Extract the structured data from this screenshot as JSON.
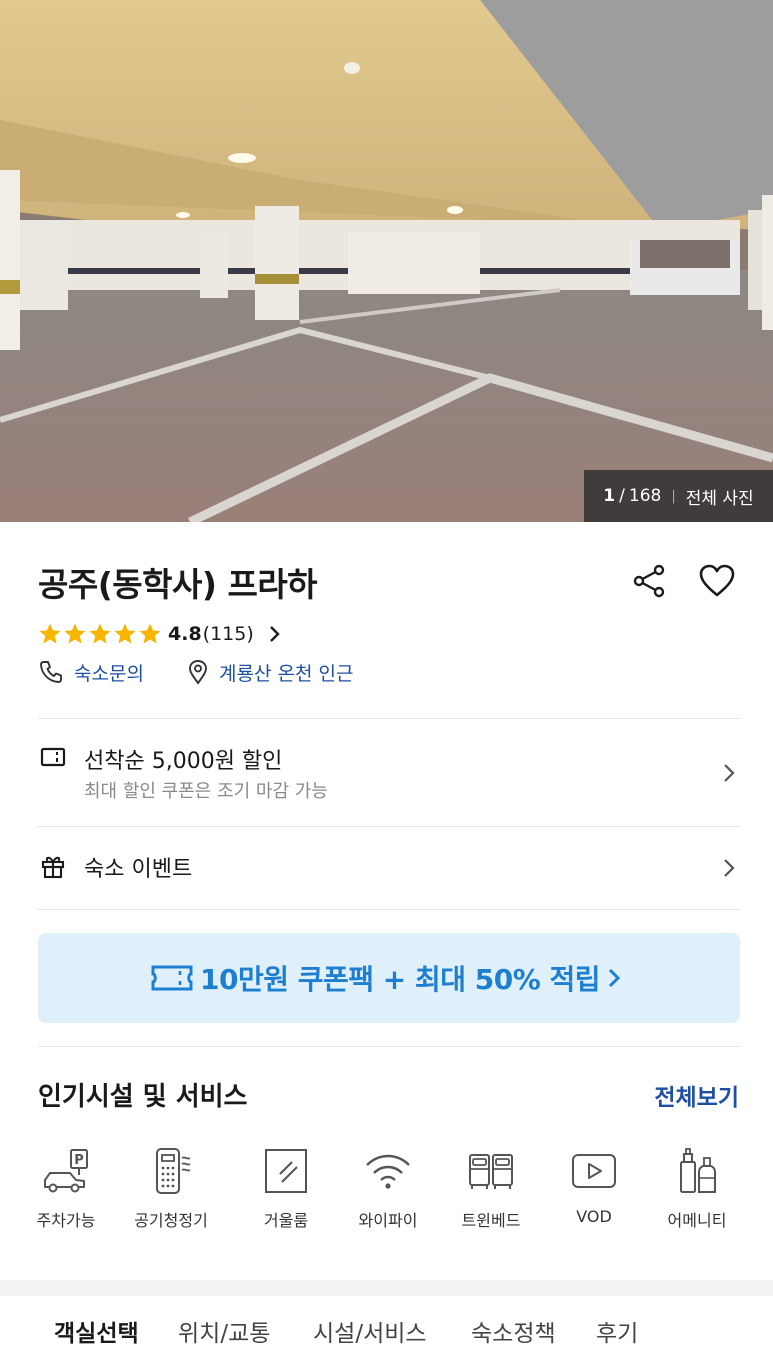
{
  "hero": {
    "photo_index": "1",
    "photo_separator": "/",
    "photo_total": "168",
    "all_photos_label": "전체 사진"
  },
  "property": {
    "name": "공주(동학사) 프라하",
    "rating_score": "4.8",
    "review_count": "(115)",
    "star_count": 5,
    "inquiry_label": "숙소문의",
    "location_label": "계룡산 온천 인근"
  },
  "coupon_row": {
    "title": "선착순 5,000원 할인",
    "subtitle": "최대 할인 쿠폰은 조기 마감 가능"
  },
  "event_row": {
    "title": "숙소 이벤트"
  },
  "promo_banner": {
    "text": "10만원 쿠폰팩 + 최대 50% 적립"
  },
  "facilities": {
    "title": "인기시설 및 서비스",
    "see_all": "전체보기",
    "items": [
      {
        "label": "주차가능",
        "icon": "parking-car-icon"
      },
      {
        "label": "공기청정기",
        "icon": "air-purifier-icon"
      },
      {
        "label": "거울룸",
        "icon": "mirror-icon"
      },
      {
        "label": "와이파이",
        "icon": "wifi-icon"
      },
      {
        "label": "트윈베드",
        "icon": "twin-bed-icon"
      },
      {
        "label": "VOD",
        "icon": "vod-play-icon"
      },
      {
        "label": "어메니티",
        "icon": "amenity-bottles-icon"
      }
    ]
  },
  "tabs": [
    {
      "label": "객실선택",
      "active": true
    },
    {
      "label": "위치/교통",
      "active": false
    },
    {
      "label": "시설/서비스",
      "active": false
    },
    {
      "label": "숙소정책",
      "active": false
    },
    {
      "label": "후기",
      "active": false
    }
  ],
  "colors": {
    "accent_blue": "#1f4fa0",
    "promo_bg": "#dff0fb",
    "promo_text": "#1e7fd0",
    "star": "#f7b500"
  }
}
